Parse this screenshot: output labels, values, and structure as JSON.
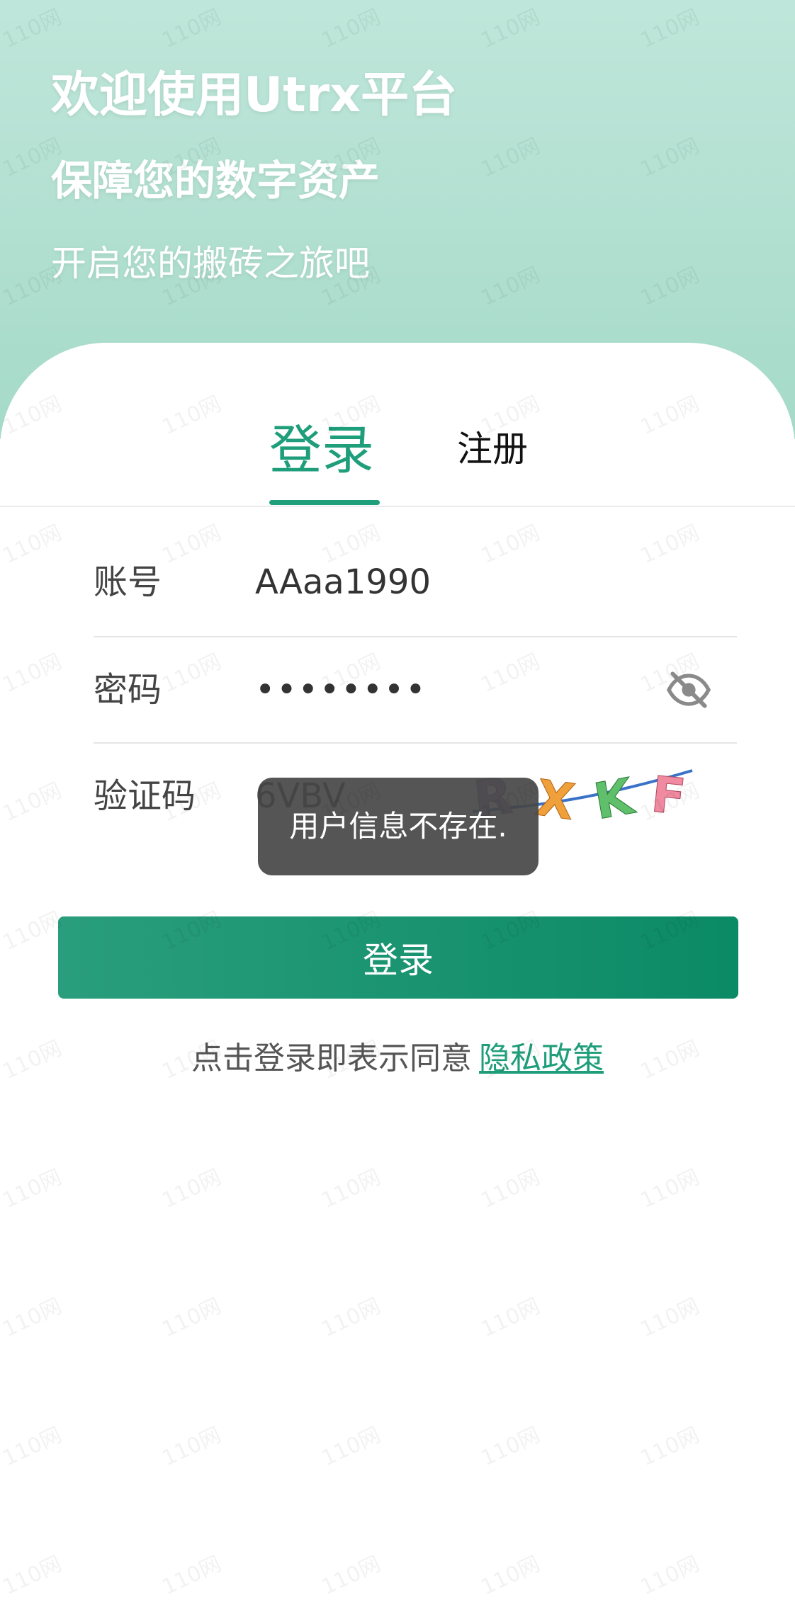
{
  "hero": {
    "title": "欢迎使用Utrx平台",
    "subtitle": "保障您的数字资产",
    "tagline": "开启您的搬砖之旅吧"
  },
  "tabs": [
    {
      "label": "登录",
      "active": true
    },
    {
      "label": "注册",
      "active": false
    }
  ],
  "form": {
    "account": {
      "label": "账号",
      "value": "AAaa1990"
    },
    "password": {
      "label": "密码",
      "value": "••••••••",
      "toggle_icon": "eye-off-icon"
    },
    "captcha": {
      "label": "验证码",
      "value": "6VBV",
      "image_text": "RXKF"
    }
  },
  "toast": {
    "text": "用户信息不存在."
  },
  "login_button": {
    "label": "登录"
  },
  "agreement": {
    "text": "点击登录即表示同意",
    "link": "隐私政策"
  },
  "watermark": {
    "text": "110网"
  },
  "colors": {
    "accent": "#1e9e7a",
    "hero_bg": "#a5dac8",
    "button_bg": "#0b8a66"
  }
}
